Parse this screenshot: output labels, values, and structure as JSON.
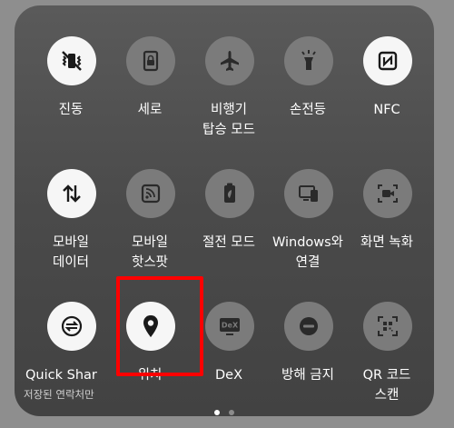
{
  "tiles": [
    {
      "label": "진동",
      "icon": "vibrate-icon",
      "state": "on"
    },
    {
      "label": "세로",
      "icon": "portrait-lock-icon",
      "state": "off"
    },
    {
      "label": "비행기\n탑승 모드",
      "icon": "airplane-icon",
      "state": "off"
    },
    {
      "label": "손전등",
      "icon": "flashlight-icon",
      "state": "off"
    },
    {
      "label": "NFC",
      "icon": "nfc-icon",
      "state": "on"
    },
    {
      "label": "모바일\n데이터",
      "icon": "mobile-data-icon",
      "state": "on"
    },
    {
      "label": "모바일\n핫스팟",
      "icon": "hotspot-icon",
      "state": "off"
    },
    {
      "label": "절전 모드",
      "icon": "battery-saver-icon",
      "state": "off"
    },
    {
      "label": "Windows와\n연결",
      "icon": "windows-link-icon",
      "state": "off"
    },
    {
      "label": "화면 녹화",
      "icon": "screen-record-icon",
      "state": "off"
    },
    {
      "label": "Quick Shar",
      "sub": "저장된 연락처만",
      "icon": "quick-share-icon",
      "state": "on"
    },
    {
      "label": "위치",
      "icon": "location-icon",
      "state": "on"
    },
    {
      "label": "DeX",
      "icon": "dex-icon",
      "state": "off"
    },
    {
      "label": "방해 금지",
      "icon": "do-not-disturb-icon",
      "state": "off"
    },
    {
      "label": "QR 코드\n스캔",
      "icon": "qr-scan-icon",
      "state": "off"
    }
  ],
  "dex_badge": "DeX",
  "pager": {
    "pages": 2,
    "active": 1
  },
  "colors": {
    "tile_on": "#f6f6f6",
    "tile_off": "#7b7b7b",
    "highlight": "#ff0000"
  }
}
